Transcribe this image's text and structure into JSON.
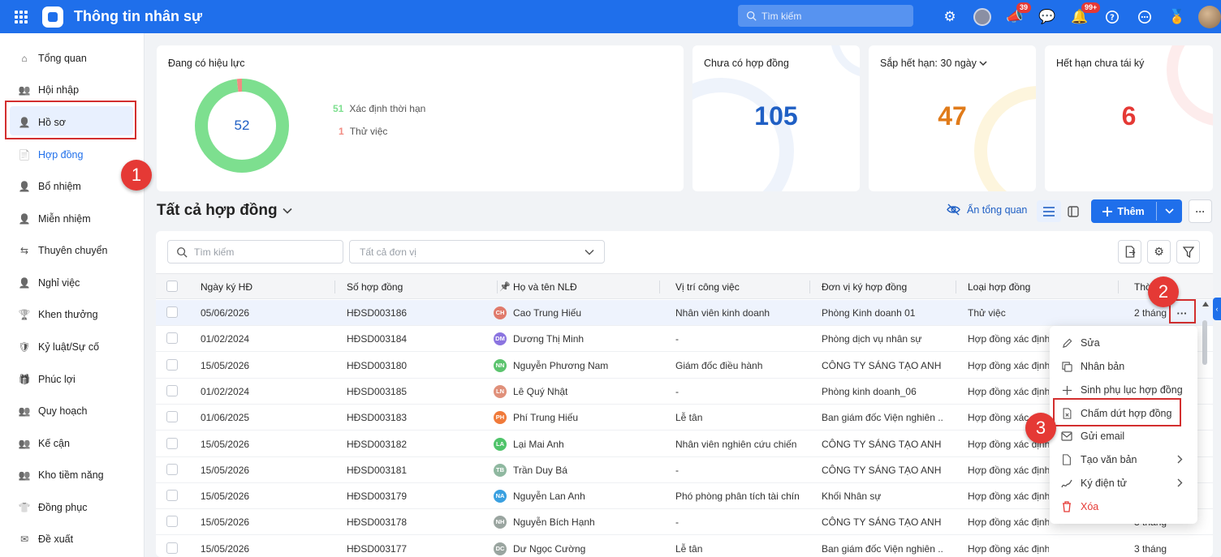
{
  "app": {
    "title": "Thông tin nhân sự",
    "search_placeholder": "Tìm kiếm",
    "badge_megaphone": "39",
    "badge_bell": "99+"
  },
  "sidebar": {
    "items": [
      {
        "label": "Tổng quan",
        "icon": "home-icon"
      },
      {
        "label": "Hội nhập",
        "icon": "users-icon"
      },
      {
        "label": "Hồ sơ",
        "icon": "user-icon"
      },
      {
        "label": "Hợp đồng",
        "icon": "document-icon"
      },
      {
        "label": "Bổ nhiệm",
        "icon": "user-plus-icon"
      },
      {
        "label": "Miễn nhiệm",
        "icon": "user-minus-icon"
      },
      {
        "label": "Thuyên chuyển",
        "icon": "transfer-icon"
      },
      {
        "label": "Nghỉ việc",
        "icon": "user-exit-icon"
      },
      {
        "label": "Khen thưởng",
        "icon": "award-icon"
      },
      {
        "label": "Kỷ luật/Sự cố",
        "icon": "shield-icon"
      },
      {
        "label": "Phúc lợi",
        "icon": "benefit-icon"
      },
      {
        "label": "Quy hoạch",
        "icon": "planning-icon"
      },
      {
        "label": "Kế cận",
        "icon": "successor-icon"
      },
      {
        "label": "Kho tiềm năng",
        "icon": "talent-pool-icon"
      },
      {
        "label": "Đồng phục",
        "icon": "shirt-icon"
      },
      {
        "label": "Đề xuất",
        "icon": "proposal-icon"
      }
    ]
  },
  "markers": [
    "1",
    "2",
    "3"
  ],
  "summary": {
    "active": {
      "title": "Đang có hiệu lực",
      "total": "52",
      "legend": [
        {
          "count": "51",
          "label": "Xác định thời hạn",
          "color": "#7ddf8f"
        },
        {
          "count": "1",
          "label": "Thử việc",
          "color": "#f28b82"
        }
      ],
      "fractions": [
        0.981,
        0.019
      ]
    },
    "no_contract": {
      "title": "Chưa có hợp đồng",
      "value": "105",
      "color": "#1f5fc4"
    },
    "expiring": {
      "title": "Sắp hết hạn:",
      "period": "30 ngày",
      "value": "47",
      "color": "#e07b1a"
    },
    "expired": {
      "title": "Hết hạn chưa tái ký",
      "value": "6",
      "color": "#e53935"
    }
  },
  "section": {
    "title": "Tất cả hợp đồng",
    "hide_overview": "Ẩn tổng quan",
    "add_button": "Thêm"
  },
  "filters": {
    "search_placeholder": "Tìm kiếm",
    "unit_placeholder": "Tất cả đơn vị"
  },
  "table": {
    "columns": [
      "Ngày ký HĐ",
      "Số hợp đồng",
      "Họ và tên NLĐ",
      "Vị trí công việc",
      "Đơn vị ký hợp đồng",
      "Loại hợp đồng",
      "Thờ"
    ],
    "rows": [
      {
        "date": "05/06/2026",
        "number": "HĐSD003186",
        "initials": "CH",
        "color": "#e07a6c",
        "name": "Cao Trung Hiếu",
        "position": "Nhân viên kinh doanh",
        "unit": "Phòng Kinh doanh 01",
        "type": "Thử việc",
        "duration": "2 tháng"
      },
      {
        "date": "01/02/2024",
        "number": "HĐSD003184",
        "initials": "DM",
        "color": "#8b74e0",
        "name": "Dương Thị Minh",
        "position": "-",
        "unit": "Phòng dịch vụ nhân sự",
        "type": "Hợp đồng xác định",
        "duration": ""
      },
      {
        "date": "15/05/2026",
        "number": "HĐSD003180",
        "initials": "NN",
        "color": "#5cc46e",
        "name": "Nguyễn Phương Nam",
        "position": "Giám đốc điều hành",
        "unit": "CÔNG TY SÁNG TẠO ANH ...",
        "type": "Hợp đồng xác định",
        "duration": ""
      },
      {
        "date": "01/02/2024",
        "number": "HĐSD003185",
        "initials": "LN",
        "color": "#e0907a",
        "name": "Lê Quý Nhật",
        "position": "-",
        "unit": "Phòng kinh doanh_06",
        "type": "Hợp đồng xác định",
        "duration": ""
      },
      {
        "date": "01/06/2025",
        "number": "HĐSD003183",
        "initials": "PH",
        "color": "#f07a3a",
        "name": "Phí Trung Hiếu",
        "position": "Lễ tân",
        "unit": "Ban giám đốc Viện nghiên ...",
        "type": "Hợp đồng xác định",
        "duration": ""
      },
      {
        "date": "15/05/2026",
        "number": "HĐSD003182",
        "initials": "LA",
        "color": "#4fc46a",
        "name": "Lại Mai Anh",
        "position": "Nhân viên nghiên cứu chiến l",
        "unit": "CÔNG TY SÁNG TẠO ANH ...",
        "type": "Hợp đồng xác định",
        "duration": ""
      },
      {
        "date": "15/05/2026",
        "number": "HĐSD003181",
        "initials": "TB",
        "color": "#8fb8a0",
        "name": "Trần Duy Bá",
        "position": "-",
        "unit": "CÔNG TY SÁNG TẠO ANH ...",
        "type": "Hợp đồng xác định",
        "duration": ""
      },
      {
        "date": "15/05/2026",
        "number": "HĐSD003179",
        "initials": "NA",
        "color": "#3aa0e0",
        "name": "Nguyễn Lan Anh",
        "position": "Phó phòng phân tích tài chính",
        "unit": "Khối Nhân sự",
        "type": "Hợp đồng xác định",
        "duration": ""
      },
      {
        "date": "15/05/2026",
        "number": "HĐSD003178",
        "initials": "NH",
        "color": "#9aa5a0",
        "name": "Nguyễn Bích Hạnh",
        "position": "-",
        "unit": "CÔNG TY SÁNG TẠO ANH ...",
        "type": "Hợp đồng xác định thời hạn",
        "duration": "3 tháng"
      },
      {
        "date": "15/05/2026",
        "number": "HĐSD003177",
        "initials": "DC",
        "color": "#9aa5a0",
        "name": "Dư Ngọc Cường",
        "position": "Lễ tân",
        "unit": "Ban giám đốc Viện nghiên ...",
        "type": "Hợp đồng xác định thời hạn",
        "duration": "3 tháng"
      }
    ]
  },
  "context_menu": {
    "items": [
      {
        "label": "Sửa",
        "icon": "pencil-icon",
        "submenu": false
      },
      {
        "label": "Nhân bản",
        "icon": "copy-icon",
        "submenu": false
      },
      {
        "label": "Sinh phụ lục hợp đồng",
        "icon": "plus-icon",
        "submenu": false
      },
      {
        "label": "Chấm dứt hợp đồng",
        "icon": "document-x-icon",
        "submenu": false
      },
      {
        "label": "Gửi email",
        "icon": "mail-icon",
        "submenu": false
      },
      {
        "label": "Tạo văn bản",
        "icon": "file-icon",
        "submenu": true
      },
      {
        "label": "Ký điện tử",
        "icon": "signature-icon",
        "submenu": true
      },
      {
        "label": "Xóa",
        "icon": "trash-icon",
        "submenu": false
      }
    ]
  }
}
